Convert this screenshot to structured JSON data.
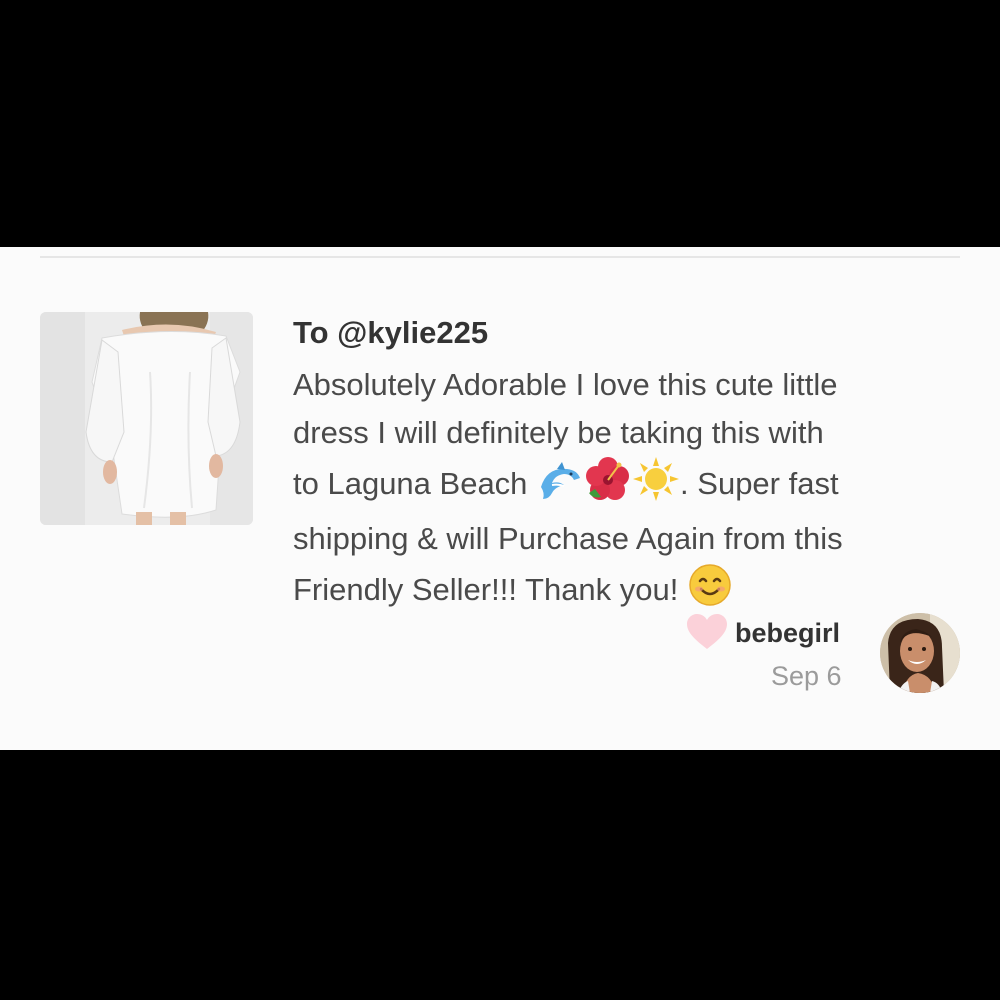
{
  "review": {
    "recipient": "To @kylie225",
    "comment_lines": [
      "Absolutely Adorable I love this cute little",
      "dress I will definitely be taking this with",
      "to Laguna Beach ",
      ". Super fast",
      "shipping & will Purchase Again from this",
      "Friendly Seller!!! Thank you! "
    ],
    "emojis": [
      "dolphin-emoji",
      "hibiscus-emoji",
      "sun-emoji",
      "smiling-face-emoji"
    ],
    "reviewer": "bebegirl",
    "date": "Sep 6"
  },
  "colors": {
    "heart": "#fbd1d9",
    "card_background": "#fbfbfb",
    "letterbox": "#000000",
    "text_dark": "#333333",
    "text_muted": "#9b9b9b"
  }
}
